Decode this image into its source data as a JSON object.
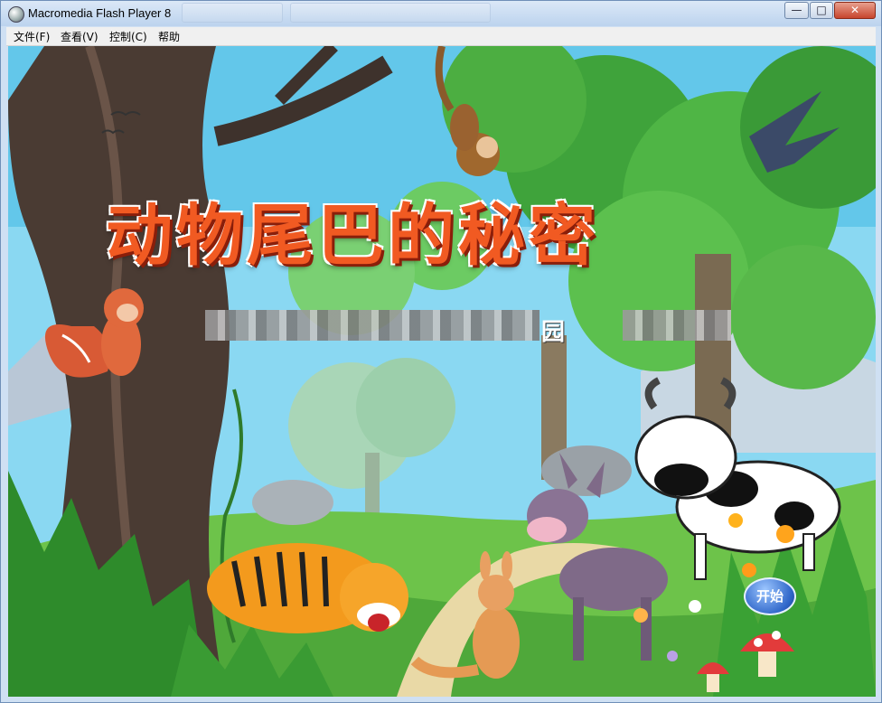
{
  "window": {
    "title": "Macromedia Flash Player 8"
  },
  "menu": {
    "items": [
      "文件(F)",
      "查看(V)",
      "控制(C)",
      "帮助"
    ]
  },
  "controls": {
    "minimize": "—",
    "maximize": "□",
    "close": "✕"
  },
  "stage": {
    "title": "动物尾巴的秘密",
    "subtitle_visible": "园",
    "start_button": "开始"
  },
  "colors": {
    "title_orange": "#f15a22",
    "sky": "#7fd3f0",
    "grass": "#5fb33a",
    "button_blue": "#2f66c9"
  },
  "icons": [
    "app-icon",
    "minimize-icon",
    "maximize-icon",
    "close-icon"
  ]
}
